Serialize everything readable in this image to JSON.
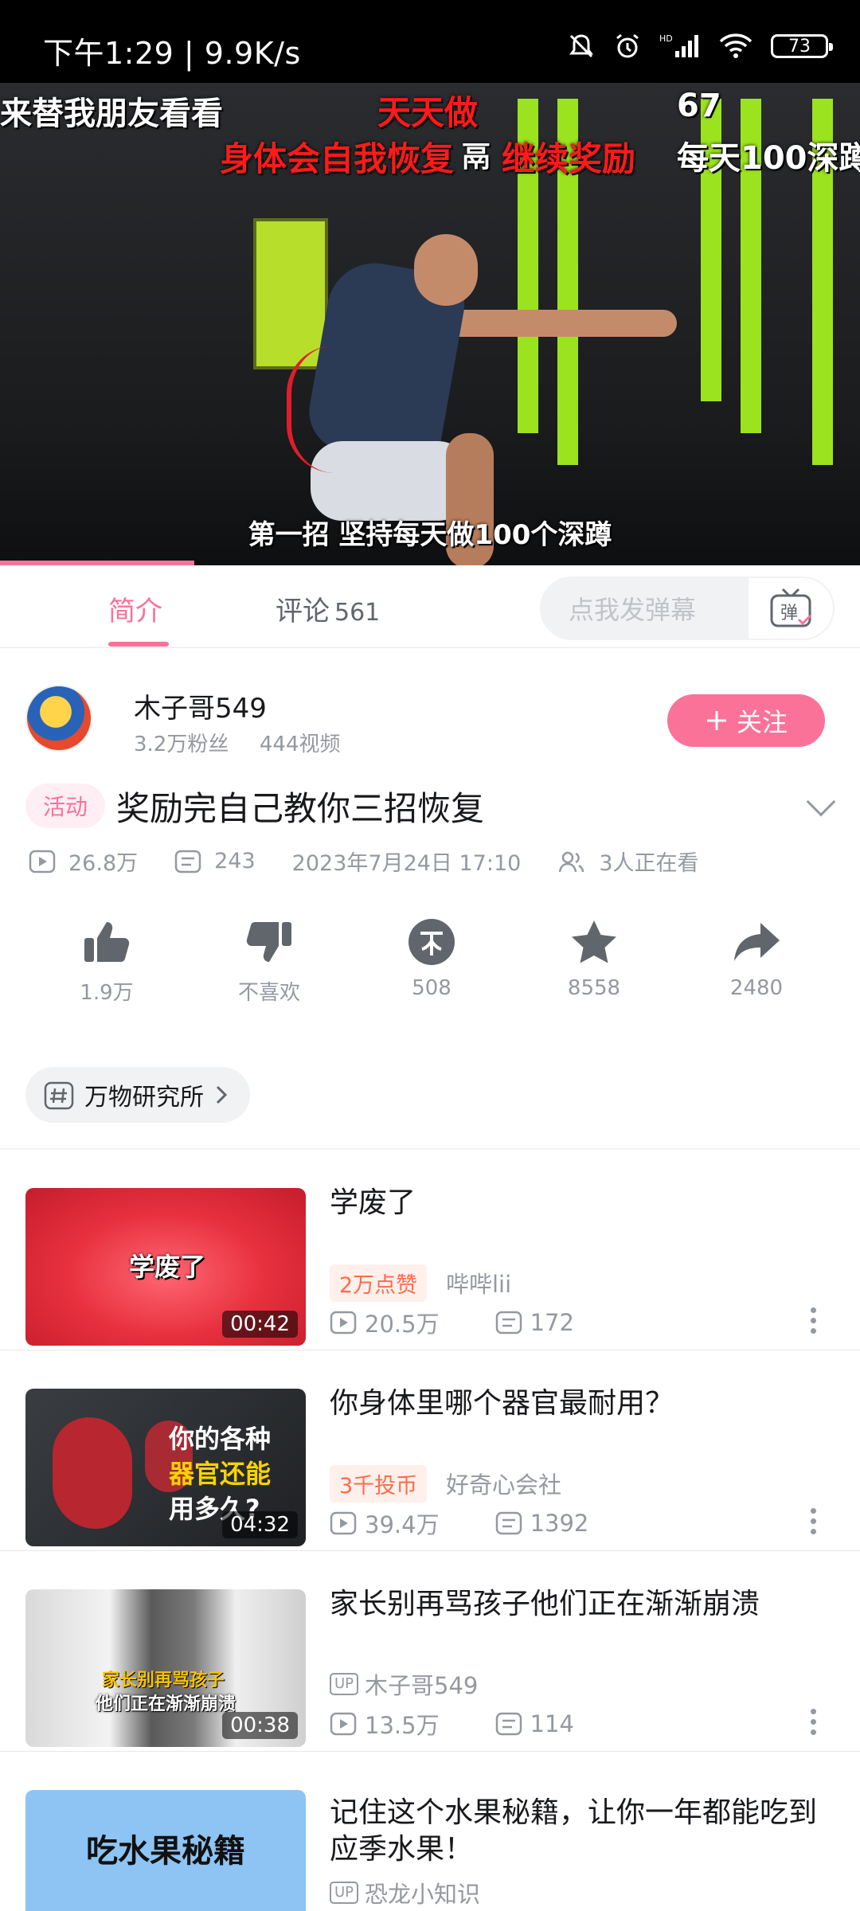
{
  "status_bar": {
    "time": "下午1:29 | 9.9K/s",
    "battery": "73",
    "icons": [
      "mute-bell-icon",
      "alarm-icon",
      "hd-signal-icon",
      "wifi-icon",
      "battery-icon"
    ]
  },
  "video": {
    "overlay_left": "来替我朋友看看",
    "overlay_red_top": "天天做",
    "overlay_red_line": "身体会自我恢复",
    "overlay_mid": "鬲",
    "overlay_red_line2": "继续奖励",
    "overlay_right_num": "67",
    "overlay_right_text": "每天100深蹲",
    "subtitle": "第一招 坚持每天做100个深蹲",
    "progress_fraction": 0.226
  },
  "tabs": {
    "intro": "简介",
    "comments": "评论",
    "comments_count": "561",
    "danmu_placeholder": "点我发弹幕",
    "danmu_btn": "弹"
  },
  "uploader": {
    "name": "木子哥549",
    "fans": "3.2万粉丝",
    "videos": "444视频",
    "follow": "关注"
  },
  "title": {
    "tag": "活动",
    "text": "奖励完自己教你三招恢复"
  },
  "meta": {
    "views": "26.8万",
    "danmaku": "243",
    "date": "2023年7月24日 17:10",
    "watching": "3人正在看"
  },
  "actions": [
    {
      "label": "1.9万",
      "icon": "thumb-up-icon"
    },
    {
      "label": "不喜欢",
      "icon": "thumb-down-icon"
    },
    {
      "label": "508",
      "icon": "coin-icon"
    },
    {
      "label": "8558",
      "icon": "star-icon"
    },
    {
      "label": "2480",
      "icon": "share-icon"
    }
  ],
  "topic": {
    "label": "万物研究所"
  },
  "related": [
    {
      "title": "学废了",
      "duration": "00:42",
      "badge": "2万点赞",
      "author": "哔哔lii",
      "views": "20.5万",
      "danmaku": "172",
      "thumb_text": "学废了"
    },
    {
      "title": "你身体里哪个器官最耐用？",
      "duration": "04:32",
      "badge": "3千投币",
      "author": "好奇心会社",
      "views": "39.4万",
      "danmaku": "1392",
      "thumb_text1": "你的各种",
      "thumb_text2": "器官还能",
      "thumb_text3": "用多久?"
    },
    {
      "title": "家长别再骂孩子他们正在渐渐崩溃",
      "duration": "00:38",
      "up_label": "UP",
      "author": "木子哥549",
      "views": "13.5万",
      "danmaku": "114",
      "thumb_text1": "家长别再骂孩子",
      "thumb_text2": "他们正在渐渐崩溃"
    },
    {
      "title": "记住这个水果秘籍，让你一年都能吃到应季水果！",
      "up_label": "UP",
      "author": "恐龙小知识",
      "thumb_text": "吃水果秘籍"
    }
  ],
  "colors": {
    "accent": "#fb7299",
    "muted": "#9499a0",
    "rack_green": "#9be31f"
  }
}
